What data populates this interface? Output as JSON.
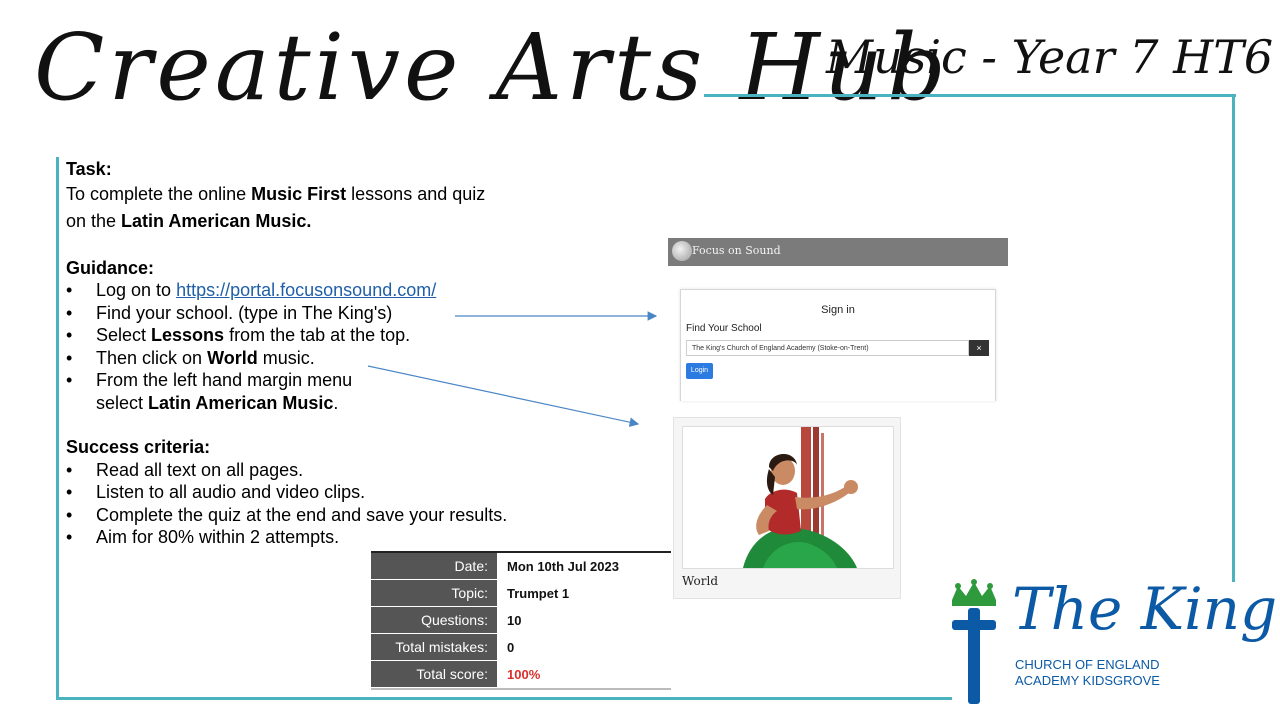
{
  "header": {
    "title": "Creative Arts Hub",
    "subtitle": "Music - Year 7 HT6"
  },
  "task": {
    "heading": "Task:",
    "line1_pre": "To complete the online ",
    "line1_bold": "Music First",
    "line1_post": " lessons and quiz",
    "line2_pre": "on the ",
    "line2_bold": "Latin American Music."
  },
  "guidance": {
    "heading": "Guidance:",
    "item1_pre": "Log on to ",
    "item1_link": "https://portal.focusonsound.com/",
    "item2": "Find your school. (type in The King's)",
    "item3_pre": "Select ",
    "item3_bold": "Lessons",
    "item3_post": " from the tab at the top.",
    "item4_pre": "Then click on ",
    "item4_bold": "World",
    "item4_post": " music.",
    "item5_line1": "From the left hand margin menu",
    "item5_pre": "select ",
    "item5_bold": "Latin American Music",
    "item5_post": "."
  },
  "success": {
    "heading": "Success criteria:",
    "items": [
      "Read all text on all pages.",
      "Listen to all audio and video clips.",
      "Complete the quiz at the end and save your results.",
      "Aim for 80% within 2 attempts."
    ]
  },
  "focus_on_sound": {
    "logo_text": "Focus on Sound",
    "signin_title": "Sign in",
    "find_label": "Find Your School",
    "school_value": "The King's Church of England Academy (Stoke-on-Trent)",
    "clear_label": "×",
    "login_label": "Login"
  },
  "world_card": {
    "label": "World"
  },
  "results": {
    "rows": [
      {
        "label": "Date:",
        "value": "Mon 10th Jul 2023"
      },
      {
        "label": "Topic:",
        "value": "Trumpet 1"
      },
      {
        "label": "Questions:",
        "value": "10"
      },
      {
        "label": "Total mistakes:",
        "value": "0"
      },
      {
        "label": "Total score:",
        "value": "100%"
      }
    ]
  },
  "school_logo": {
    "name": "The King's",
    "line1": "CHURCH OF ENGLAND",
    "line2": "ACADEMY KIDSGROVE",
    "colors": {
      "blue": "#0c5aa5",
      "green": "#2e9a3c"
    }
  },
  "colors": {
    "frame": "#4bb3bf",
    "link": "#1f5fa8",
    "arrow": "#4a86c5",
    "score_red": "#d9302c"
  }
}
